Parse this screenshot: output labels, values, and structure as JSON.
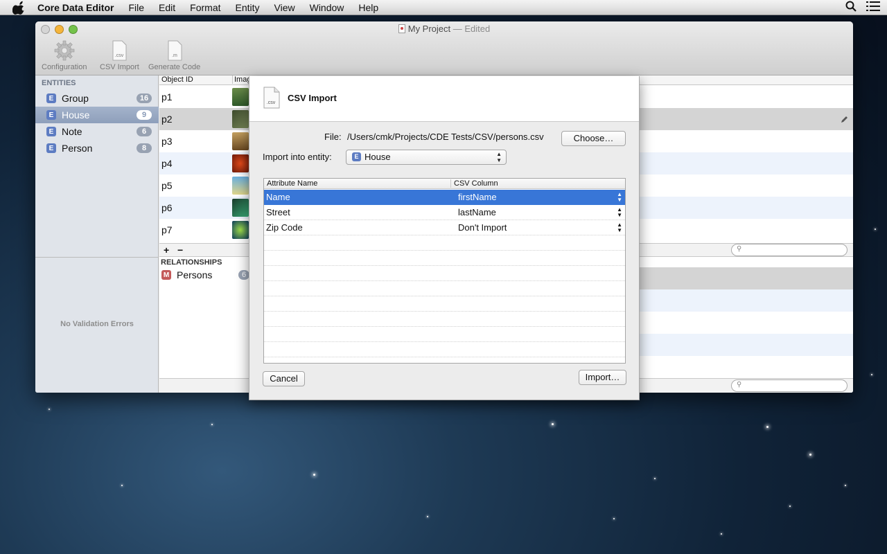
{
  "menubar": {
    "app_name": "Core Data Editor",
    "items": [
      "File",
      "Edit",
      "Format",
      "Entity",
      "View",
      "Window",
      "Help"
    ]
  },
  "window": {
    "title": "My Project",
    "title_suffix": "— Edited",
    "toolbar": {
      "configuration": "Configuration",
      "csv_import": "CSV Import",
      "generate_code": "Generate Code",
      "csv_icon_text": ".csv",
      "m_icon_text": ".m"
    }
  },
  "sidebar": {
    "header": "ENTITIES",
    "entities": [
      {
        "badge": "E",
        "name": "Group",
        "count": "16"
      },
      {
        "badge": "E",
        "name": "House",
        "count": "9",
        "selected": true
      },
      {
        "badge": "E",
        "name": "Note",
        "count": "6"
      },
      {
        "badge": "E",
        "name": "Person",
        "count": "8"
      }
    ],
    "validation": "No Validation Errors"
  },
  "table": {
    "columns": [
      "Object ID",
      "Imag"
    ],
    "rows": [
      "p1",
      "p2",
      "p3",
      "p4",
      "p5",
      "p6",
      "p7"
    ],
    "add_label": "+",
    "remove_label": "−"
  },
  "relationships": {
    "header": "RELATIONSHIPS",
    "item": {
      "badge": "M",
      "name": "Persons",
      "count": "6"
    }
  },
  "sheet": {
    "title": "CSV Import",
    "file_icon_text": ".csv",
    "file_label": "File:",
    "file_path": "/Users/cmk/Projects/CDE Tests/CSV/persons.csv",
    "choose_button": "Choose…",
    "entity_label": "Import into entity:",
    "entity_badge": "E",
    "entity_value": "House",
    "mapping": {
      "columns": [
        "Attribute Name",
        "CSV Column"
      ],
      "rows": [
        {
          "attribute": "Name",
          "csv": "firstName",
          "selected": true
        },
        {
          "attribute": "Street",
          "csv": "lastName"
        },
        {
          "attribute": "Zip Code",
          "csv": "Don't Import"
        }
      ]
    },
    "cancel_button": "Cancel",
    "import_button": "Import…"
  },
  "colors": {
    "selection": "#3876d7",
    "sidebar_selection": "#8e9fbb"
  }
}
